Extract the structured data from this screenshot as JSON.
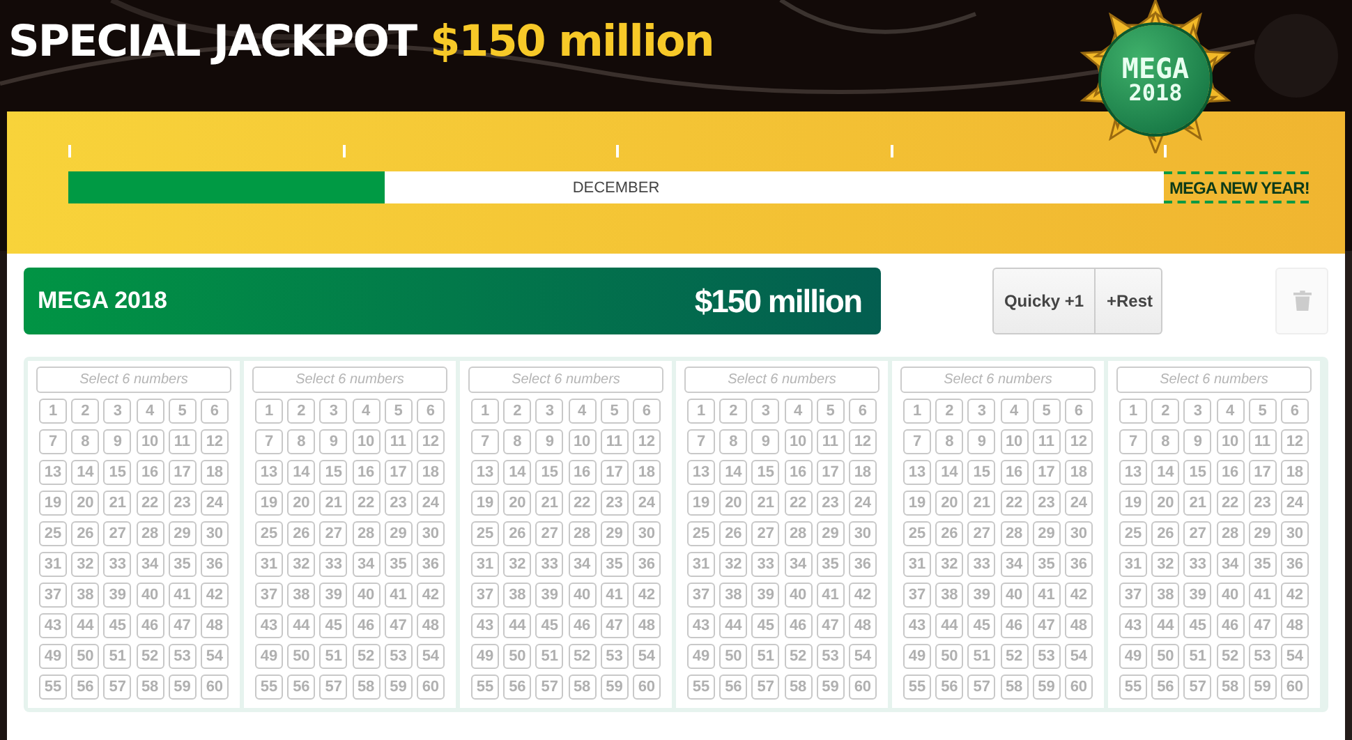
{
  "headline": {
    "title": "SPECIAL JACKPOT",
    "amount": "$150 million"
  },
  "logo": {
    "line1": "MEGA",
    "line2": "2018"
  },
  "timeline": {
    "level": 0.289,
    "month": "DECEMBER",
    "goal": "MEGA NEW YEAR!"
  },
  "banner": {
    "name": "MEGA 2018",
    "jackpot": "$150 million"
  },
  "buttons": [
    {
      "label": "Quicky +1"
    },
    {
      "label": "+Rest"
    }
  ],
  "delete_button": {
    "disabled": true
  },
  "tickets": [
    {
      "placeholder": "Select 6 numbers",
      "numbers": [
        "1",
        "2",
        "3",
        "4",
        "5",
        "6",
        "7",
        "8",
        "9",
        "10",
        "11",
        "12",
        "13",
        "14",
        "15",
        "16",
        "17",
        "18",
        "19",
        "20",
        "21",
        "22",
        "23",
        "24",
        "25",
        "26",
        "27",
        "28",
        "29",
        "30",
        "31",
        "32",
        "33",
        "34",
        "35",
        "36",
        "37",
        "38",
        "39",
        "40",
        "41",
        "42",
        "43",
        "44",
        "45",
        "46",
        "47",
        "48",
        "49",
        "50",
        "51",
        "52",
        "53",
        "54",
        "55",
        "56",
        "57",
        "58",
        "59",
        "60"
      ]
    },
    {
      "placeholder": "Select 6 numbers",
      "numbers": [
        "1",
        "2",
        "3",
        "4",
        "5",
        "6",
        "7",
        "8",
        "9",
        "10",
        "11",
        "12",
        "13",
        "14",
        "15",
        "16",
        "17",
        "18",
        "19",
        "20",
        "21",
        "22",
        "23",
        "24",
        "25",
        "26",
        "27",
        "28",
        "29",
        "30",
        "31",
        "32",
        "33",
        "34",
        "35",
        "36",
        "37",
        "38",
        "39",
        "40",
        "41",
        "42",
        "43",
        "44",
        "45",
        "46",
        "47",
        "48",
        "49",
        "50",
        "51",
        "52",
        "53",
        "54",
        "55",
        "56",
        "57",
        "58",
        "59",
        "60"
      ]
    },
    {
      "placeholder": "Select 6 numbers",
      "numbers": [
        "1",
        "2",
        "3",
        "4",
        "5",
        "6",
        "7",
        "8",
        "9",
        "10",
        "11",
        "12",
        "13",
        "14",
        "15",
        "16",
        "17",
        "18",
        "19",
        "20",
        "21",
        "22",
        "23",
        "24",
        "25",
        "26",
        "27",
        "28",
        "29",
        "30",
        "31",
        "32",
        "33",
        "34",
        "35",
        "36",
        "37",
        "38",
        "39",
        "40",
        "41",
        "42",
        "43",
        "44",
        "45",
        "46",
        "47",
        "48",
        "49",
        "50",
        "51",
        "52",
        "53",
        "54",
        "55",
        "56",
        "57",
        "58",
        "59",
        "60"
      ]
    },
    {
      "placeholder": "Select 6 numbers",
      "numbers": [
        "1",
        "2",
        "3",
        "4",
        "5",
        "6",
        "7",
        "8",
        "9",
        "10",
        "11",
        "12",
        "13",
        "14",
        "15",
        "16",
        "17",
        "18",
        "19",
        "20",
        "21",
        "22",
        "23",
        "24",
        "25",
        "26",
        "27",
        "28",
        "29",
        "30",
        "31",
        "32",
        "33",
        "34",
        "35",
        "36",
        "37",
        "38",
        "39",
        "40",
        "41",
        "42",
        "43",
        "44",
        "45",
        "46",
        "47",
        "48",
        "49",
        "50",
        "51",
        "52",
        "53",
        "54",
        "55",
        "56",
        "57",
        "58",
        "59",
        "60"
      ]
    },
    {
      "placeholder": "Select 6 numbers",
      "numbers": [
        "1",
        "2",
        "3",
        "4",
        "5",
        "6",
        "7",
        "8",
        "9",
        "10",
        "11",
        "12",
        "13",
        "14",
        "15",
        "16",
        "17",
        "18",
        "19",
        "20",
        "21",
        "22",
        "23",
        "24",
        "25",
        "26",
        "27",
        "28",
        "29",
        "30",
        "31",
        "32",
        "33",
        "34",
        "35",
        "36",
        "37",
        "38",
        "39",
        "40",
        "41",
        "42",
        "43",
        "44",
        "45",
        "46",
        "47",
        "48",
        "49",
        "50",
        "51",
        "52",
        "53",
        "54",
        "55",
        "56",
        "57",
        "58",
        "59",
        "60"
      ]
    },
    {
      "placeholder": "Select 6 numbers",
      "numbers": [
        "1",
        "2",
        "3",
        "4",
        "5",
        "6",
        "7",
        "8",
        "9",
        "10",
        "11",
        "12",
        "13",
        "14",
        "15",
        "16",
        "17",
        "18",
        "19",
        "20",
        "21",
        "22",
        "23",
        "24",
        "25",
        "26",
        "27",
        "28",
        "29",
        "30",
        "31",
        "32",
        "33",
        "34",
        "35",
        "36",
        "37",
        "38",
        "39",
        "40",
        "41",
        "42",
        "43",
        "44",
        "45",
        "46",
        "47",
        "48",
        "49",
        "50",
        "51",
        "52",
        "53",
        "54",
        "55",
        "56",
        "57",
        "58",
        "59",
        "60"
      ]
    }
  ]
}
